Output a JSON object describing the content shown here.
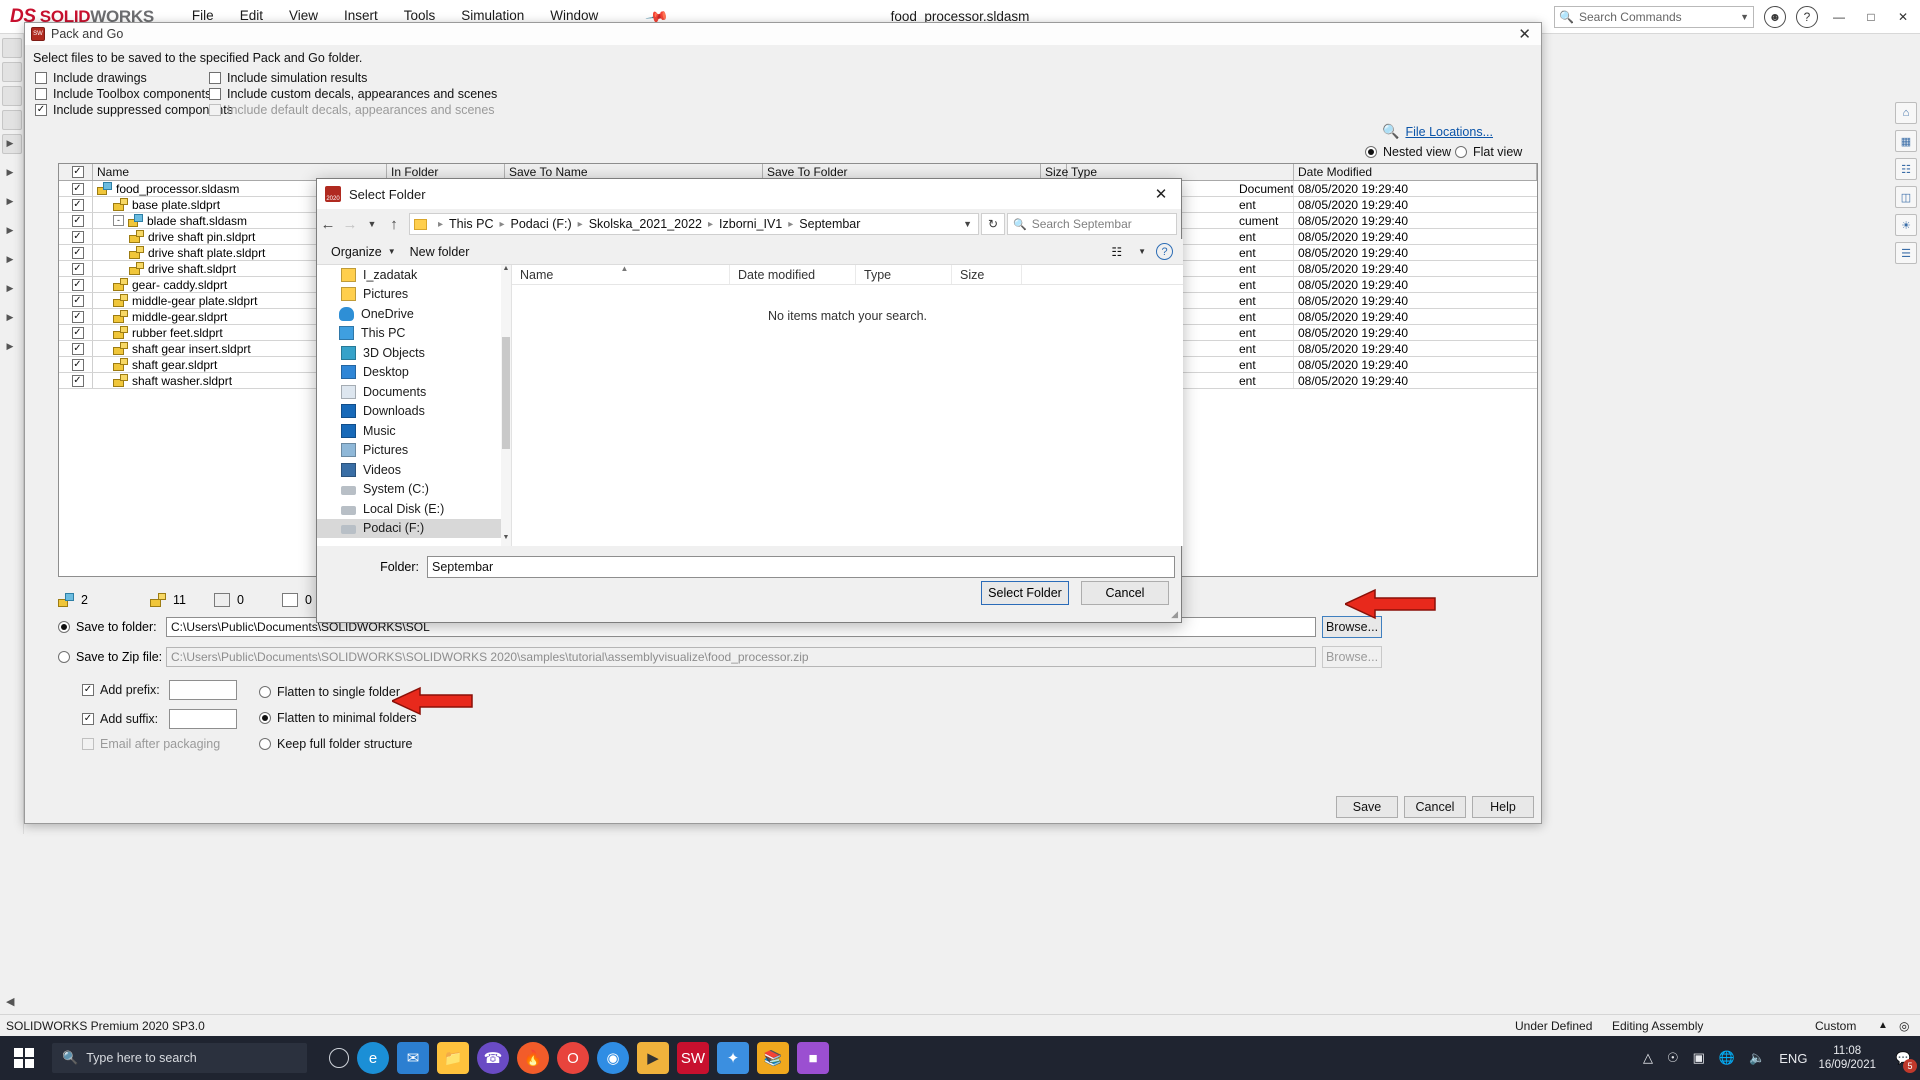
{
  "app": {
    "brand_ds": "DS",
    "brand_solid": "SOLID",
    "brand_works": "WORKS",
    "document_title": "food_processor.sldasm",
    "menu": [
      "File",
      "Edit",
      "View",
      "Insert",
      "Tools",
      "Simulation",
      "Window"
    ],
    "search_placeholder": "Search Commands"
  },
  "status_bar": {
    "left": "SOLIDWORKS Premium 2020 SP3.0",
    "under_defined": "Under Defined",
    "editing": "Editing Assembly",
    "custom": "Custom"
  },
  "taskbar": {
    "search_placeholder": "Type here to search",
    "language": "ENG",
    "time": "11:08",
    "date": "16/09/2021",
    "notification_count": "5"
  },
  "pack_and_go": {
    "title": "Pack and Go",
    "instruction": "Select files to be saved to the specified Pack and Go folder.",
    "options": [
      {
        "label": "Include drawings",
        "checked": false,
        "disabled": false
      },
      {
        "label": "Include Toolbox components",
        "checked": false,
        "disabled": false
      },
      {
        "label": "Include suppressed components",
        "checked": true,
        "disabled": false
      },
      {
        "label": "Include simulation results",
        "checked": false,
        "disabled": false
      },
      {
        "label": "Include custom decals, appearances and scenes",
        "checked": false,
        "disabled": false
      },
      {
        "label": "Include default decals, appearances and scenes",
        "checked": false,
        "disabled": true
      }
    ],
    "file_locations_link": "File Locations...",
    "view_modes": [
      {
        "label": "Nested view",
        "selected": true
      },
      {
        "label": "Flat view",
        "selected": false
      }
    ],
    "columns": [
      "Name",
      "In Folder",
      "Save To Name",
      "Save To Folder",
      "Size",
      "Type",
      "Date Modified"
    ],
    "rows": [
      {
        "name": "food_processor.sldasm",
        "icon": "assembly-icon",
        "indent": 0,
        "checked": true,
        "expander": "",
        "type": "Document",
        "date": "08/05/2020 19:29:40"
      },
      {
        "name": "base plate.sldprt",
        "icon": "part-icon",
        "indent": 1,
        "checked": true,
        "expander": "",
        "type": "ent",
        "date": "08/05/2020 19:29:40"
      },
      {
        "name": "blade shaft.sldasm",
        "icon": "assembly-icon",
        "indent": 1,
        "checked": true,
        "expander": "-",
        "type": "cument",
        "date": "08/05/2020 19:29:40"
      },
      {
        "name": "drive shaft pin.sldprt",
        "icon": "part-icon",
        "indent": 2,
        "checked": true,
        "expander": "",
        "type": "ent",
        "date": "08/05/2020 19:29:40"
      },
      {
        "name": "drive shaft plate.sldprt",
        "icon": "part-icon",
        "indent": 2,
        "checked": true,
        "expander": "",
        "type": "ent",
        "date": "08/05/2020 19:29:40"
      },
      {
        "name": "drive shaft.sldprt",
        "icon": "part-icon",
        "indent": 2,
        "checked": true,
        "expander": "",
        "type": "ent",
        "date": "08/05/2020 19:29:40"
      },
      {
        "name": "gear- caddy.sldprt",
        "icon": "part-icon",
        "indent": 1,
        "checked": true,
        "expander": "",
        "type": "ent",
        "date": "08/05/2020 19:29:40"
      },
      {
        "name": "middle-gear plate.sldprt",
        "icon": "part-icon",
        "indent": 1,
        "checked": true,
        "expander": "",
        "type": "ent",
        "date": "08/05/2020 19:29:40"
      },
      {
        "name": "middle-gear.sldprt",
        "icon": "part-icon",
        "indent": 1,
        "checked": true,
        "expander": "",
        "type": "ent",
        "date": "08/05/2020 19:29:40"
      },
      {
        "name": "rubber feet.sldprt",
        "icon": "part-icon",
        "indent": 1,
        "checked": true,
        "expander": "",
        "type": "ent",
        "date": "08/05/2020 19:29:40"
      },
      {
        "name": "shaft gear insert.sldprt",
        "icon": "part-icon",
        "indent": 1,
        "checked": true,
        "expander": "",
        "type": "ent",
        "date": "08/05/2020 19:29:40"
      },
      {
        "name": "shaft gear.sldprt",
        "icon": "part-icon",
        "indent": 1,
        "checked": true,
        "expander": "",
        "type": "ent",
        "date": "08/05/2020 19:29:40"
      },
      {
        "name": "shaft washer.sldprt",
        "icon": "part-icon",
        "indent": 1,
        "checked": true,
        "expander": "",
        "type": "ent",
        "date": "08/05/2020 19:29:40"
      }
    ],
    "counts": [
      {
        "icon": "assembly-icon",
        "value": "2"
      },
      {
        "icon": "part-icon",
        "value": "11"
      },
      {
        "icon": "drawing-icon",
        "value": "0"
      },
      {
        "icon": "decal-icon",
        "value": "0"
      }
    ],
    "save_to_folder": {
      "label": "Save to folder:",
      "selected": true,
      "value": "C:\\Users\\Public\\Documents\\SOLIDWORKS\\SOL",
      "browse_label": "Browse..."
    },
    "save_to_zip": {
      "label": "Save to Zip file:",
      "selected": false,
      "value": "C:\\Users\\Public\\Documents\\SOLIDWORKS\\SOLIDWORKS 2020\\samples\\tutorial\\assemblyvisualize\\food_processor.zip",
      "browse_label": "Browse..."
    },
    "add_prefix": {
      "label": "Add prefix:",
      "checked": true,
      "value": ""
    },
    "add_suffix": {
      "label": "Add suffix:",
      "checked": true,
      "value": ""
    },
    "email_after": {
      "label": "Email after packaging",
      "checked": false,
      "disabled": true
    },
    "flatten_options": [
      {
        "label": "Flatten to single folder",
        "selected": false
      },
      {
        "label": "Flatten to minimal folders",
        "selected": true
      },
      {
        "label": "Keep full folder structure",
        "selected": false
      }
    ],
    "buttons": {
      "save": "Save",
      "cancel": "Cancel",
      "help": "Help"
    }
  },
  "select_folder": {
    "title": "Select Folder",
    "breadcrumb": [
      "This PC",
      "Podaci (F:)",
      "Skolska_2021_2022",
      "Izborni_IV1",
      "Septembar"
    ],
    "search_placeholder": "Search Septembar",
    "toolbar": {
      "organize": "Organize",
      "new_folder": "New folder"
    },
    "nav_items": [
      {
        "label": "I_zadatak",
        "icon": "folder-icon",
        "indent": 1,
        "selected": false
      },
      {
        "label": "Pictures",
        "icon": "folder-icon",
        "indent": 1,
        "selected": false
      },
      {
        "label": "OneDrive",
        "icon": "onedrive-icon",
        "indent": 0,
        "selected": false
      },
      {
        "label": "This PC",
        "icon": "pc-icon",
        "indent": 0,
        "selected": false
      },
      {
        "label": "3D Objects",
        "icon": "3dobjects-icon",
        "indent": 1,
        "selected": false
      },
      {
        "label": "Desktop",
        "icon": "desktop-icon",
        "indent": 1,
        "selected": false
      },
      {
        "label": "Documents",
        "icon": "documents-icon",
        "indent": 1,
        "selected": false
      },
      {
        "label": "Downloads",
        "icon": "downloads-icon",
        "indent": 1,
        "selected": false
      },
      {
        "label": "Music",
        "icon": "music-icon",
        "indent": 1,
        "selected": false
      },
      {
        "label": "Pictures",
        "icon": "pictures-icon",
        "indent": 1,
        "selected": false
      },
      {
        "label": "Videos",
        "icon": "videos-icon",
        "indent": 1,
        "selected": false
      },
      {
        "label": "System (C:)",
        "icon": "drive-system-icon",
        "indent": 1,
        "selected": false
      },
      {
        "label": "Local Disk (E:)",
        "icon": "drive-icon",
        "indent": 1,
        "selected": false
      },
      {
        "label": "Podaci (F:)",
        "icon": "drive-icon",
        "indent": 1,
        "selected": true
      }
    ],
    "columns": [
      "Name",
      "Date modified",
      "Type",
      "Size"
    ],
    "empty_message": "No items match your search.",
    "folder_label": "Folder:",
    "folder_value": "Septembar",
    "select_button": "Select Folder",
    "cancel_button": "Cancel"
  }
}
